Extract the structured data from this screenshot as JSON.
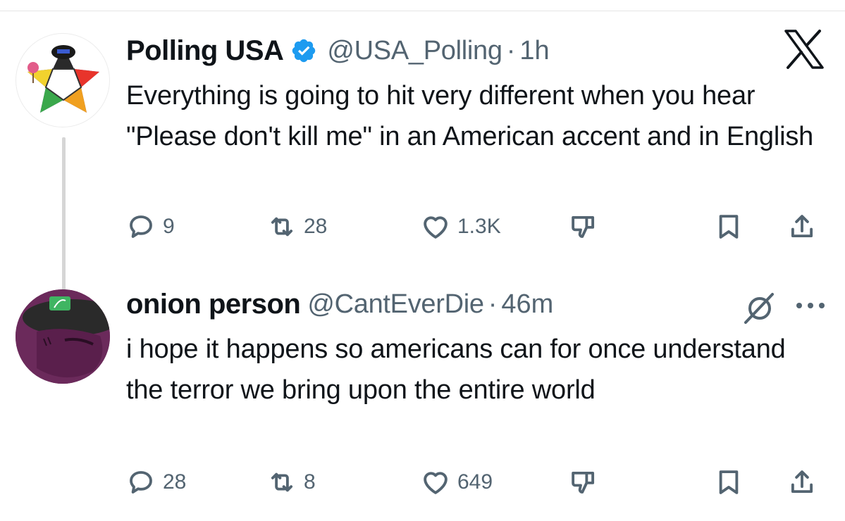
{
  "tweets": [
    {
      "display_name": "Polling USA",
      "verified": true,
      "handle": "@USA_Polling",
      "separator": "·",
      "time": "1h",
      "text": "Everything is going to hit very different when you hear \"Please don't kill me\" in an American accent and in English",
      "replies": "9",
      "retweets": "28",
      "likes": "1.3K",
      "avatar_icon": "star-emblem-avatar"
    },
    {
      "display_name": "onion person",
      "verified": false,
      "handle": "@CantEverDie",
      "separator": "·",
      "time": "46m",
      "text": "i hope it happens so americans can for once understand the terror we bring upon the entire world",
      "replies": "28",
      "retweets": "8",
      "likes": "649",
      "avatar_icon": "purple-character-avatar"
    }
  ],
  "icons": {
    "reply": "reply-icon",
    "retweet": "retweet-icon",
    "like": "heart-icon",
    "dislike": "dislike-icon",
    "bookmark": "bookmark-icon",
    "share": "share-icon",
    "brand": "x-logo-icon",
    "grok": "grok-icon",
    "more": "more-icon"
  },
  "colors": {
    "text": "#0f1419",
    "secondary": "#536471",
    "verified": "#1d9bf0",
    "thread_line": "#d6d6d6"
  }
}
